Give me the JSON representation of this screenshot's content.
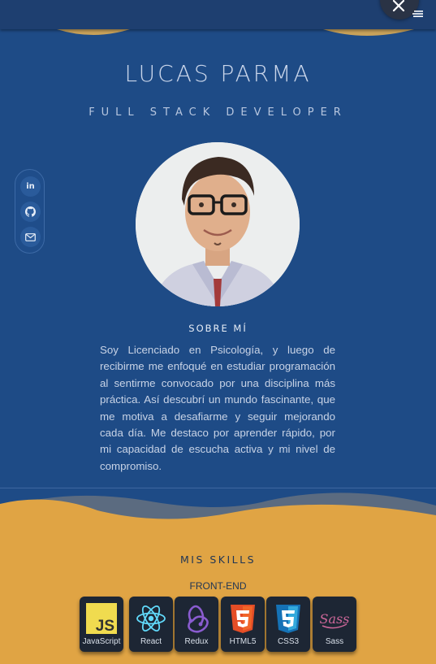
{
  "header": {
    "close_label": "close",
    "menu_label": "menu"
  },
  "hero": {
    "name": "LUCAS PARMA",
    "role": "FULL STACK DEVELOPER",
    "social": [
      {
        "icon": "linkedin-icon",
        "glyph": "in"
      },
      {
        "icon": "github-icon",
        "glyph": ""
      },
      {
        "icon": "mail-icon",
        "glyph": ""
      }
    ]
  },
  "about": {
    "title": "SOBRE MÍ",
    "text": "Soy Licenciado en Psicología, y luego de recibirme me enfoqué en estudiar programación al sentirme convocado por una disciplina más práctica. Así descubrí un mundo fascinante, que me motiva a desafiarme y seguir mejorando cada día. Me destaco por aprender rápido, por mi capacidad de escucha activa y mi nivel de compromiso."
  },
  "skills": {
    "title": "MIS SKILLS",
    "category": "FRONT-END",
    "items": [
      {
        "label": "JavaScript",
        "icon": "javascript-icon",
        "color": "#f0db4f"
      },
      {
        "label": "React",
        "icon": "react-icon",
        "color": "#61dafb"
      },
      {
        "label": "Redux",
        "icon": "redux-icon",
        "color": "#764abc"
      },
      {
        "label": "HTML5",
        "icon": "html5-icon",
        "color": "#e44d26"
      },
      {
        "label": "CSS3",
        "icon": "css3-icon",
        "color": "#2965f1"
      },
      {
        "label": "Sass",
        "icon": "sass-icon",
        "color": "#cd6799"
      }
    ]
  },
  "colors": {
    "primary": "#1e4b86",
    "accent": "#e0a444",
    "dark": "#1d2634"
  }
}
